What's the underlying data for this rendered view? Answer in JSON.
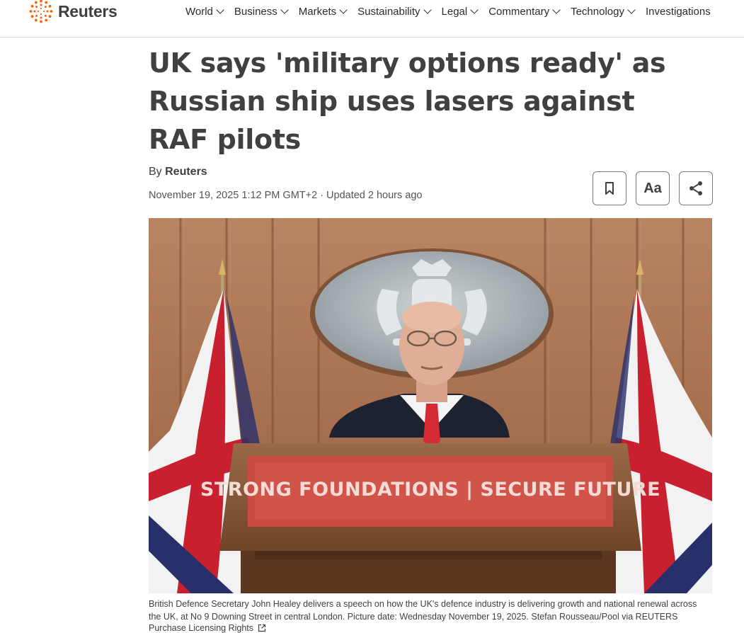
{
  "brand": {
    "name": "Reuters",
    "accent": "#fa6400"
  },
  "nav": {
    "items": [
      {
        "label": "World",
        "has_dropdown": true
      },
      {
        "label": "Business",
        "has_dropdown": true
      },
      {
        "label": "Markets",
        "has_dropdown": true
      },
      {
        "label": "Sustainability",
        "has_dropdown": true
      },
      {
        "label": "Legal",
        "has_dropdown": true
      },
      {
        "label": "Commentary",
        "has_dropdown": true
      },
      {
        "label": "Technology",
        "has_dropdown": true
      },
      {
        "label": "Investigations",
        "has_dropdown": false
      }
    ]
  },
  "article": {
    "headline": "UK says 'military options ready' as Russian ship uses lasers against RAF pilots",
    "byline_prefix": "By",
    "author": "Reuters",
    "dateline": "November 19, 2025 1:12 PM GMT+2 · Updated 2 hours ago",
    "tools": [
      {
        "name": "bookmark",
        "icon": "bookmark-icon"
      },
      {
        "name": "font-size",
        "label": "Aa"
      },
      {
        "name": "share",
        "icon": "share-icon"
      }
    ],
    "image": {
      "lectern_sign": "STRONG FOUNDATIONS | SECURE FUTURE",
      "caption": "British Defence Secretary John Healey delivers a speech on how the UK's defence industry is delivering growth and national renewal across the UK, at No 9 Downing Street in central London. Picture date: Wednesday November 19, 2025. Stefan Rousseau/Pool via REUTERS",
      "rights_label": "Purchase Licensing Rights",
      "rights_icon": "external-link-icon"
    }
  }
}
